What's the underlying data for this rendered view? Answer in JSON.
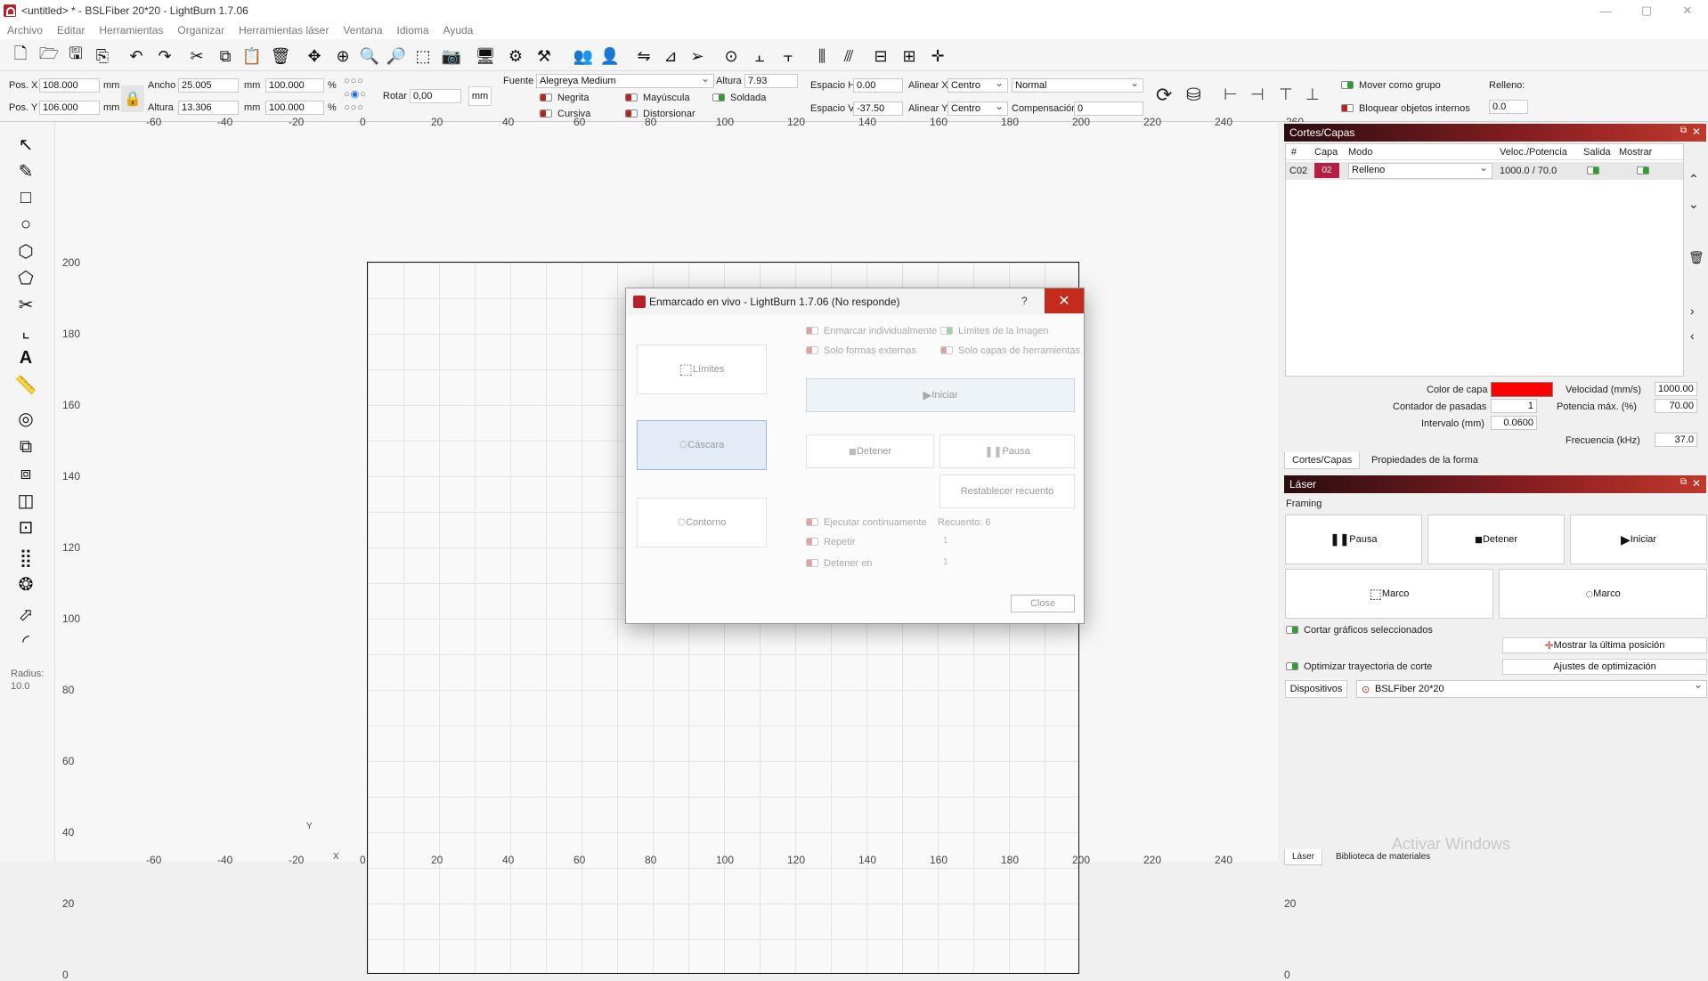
{
  "window": {
    "title": "<untitled> * - BSLFiber 20*20 - LightBurn 1.7.06",
    "minimize": "—",
    "maximize": "▢",
    "close": "✕"
  },
  "menu": [
    "Archivo",
    "Editar",
    "Herramientas",
    "Organizar",
    "Herramientas láser",
    "Ventana",
    "Idioma",
    "Ayuda"
  ],
  "shape_props": {
    "posx_label": "Pos. X",
    "posx_value": "108.000",
    "posy_label": "Pos. Y",
    "posy_value": "106.000",
    "unit": "mm",
    "width_label": "Ancho",
    "width_value": "25.005",
    "height_label": "Altura",
    "height_value": "13.306",
    "width_pct": "100.000",
    "height_pct": "100.000",
    "pct": "%",
    "rotate_label": "Rotar",
    "rotate_value": "0,00",
    "mm_button": "mm"
  },
  "text_props": {
    "font_label": "Fuente",
    "font_value": "Alegreya Medium",
    "height_label": "Altura",
    "height_value": "7.93",
    "bold": "Negrita",
    "italic": "Cursiva",
    "upper": "Mayúscula",
    "distort": "Distorsionar",
    "weld": "Soldada",
    "hspace_label": "Espacio H",
    "hspace_value": "0.00",
    "vspace_label": "Espacio V",
    "vspace_value": "-37.50",
    "alignx_label": "Alinear X",
    "alignx_value": "Centro",
    "aligny_label": "Alinear Y",
    "aligny_value": "Centro",
    "mode_value": "Normal",
    "comp_label": "Compensación",
    "comp_value": "0",
    "move_group": "Mover como grupo",
    "lock_inner": "Bloquear objetos internos",
    "fill_label": "Relleno:",
    "fill_value": "0.0"
  },
  "left_radius": {
    "label": "Radius:",
    "value": "10.0"
  },
  "ruler": {
    "x": [
      "-60",
      "-40",
      "-20",
      "0",
      "20",
      "40",
      "60",
      "80",
      "100",
      "120",
      "140",
      "160",
      "180",
      "200",
      "220",
      "240",
      "260"
    ],
    "y": [
      "200",
      "180",
      "160",
      "140",
      "120",
      "100",
      "80",
      "60",
      "40",
      "20",
      "0"
    ],
    "x_axis": "X",
    "y_axis": "Y"
  },
  "cuts_panel": {
    "title": "Cortes/Capas",
    "headers": [
      "#",
      "Capa",
      "Modo",
      "Veloc./Potencia",
      "Salida",
      "Mostrar"
    ],
    "row": {
      "id": "C02",
      "layer": "02",
      "mode": "Relleno",
      "speed_power": "1000.0 / 70.0"
    },
    "layer_color_label": "Color de capa",
    "layer_color": "#ff0000",
    "speed_label": "Velocidad (mm/s)",
    "speed_value": "1000.00",
    "passes_label": "Contador de pasadas",
    "passes_value": "1",
    "maxpower_label": "Potencia máx. (%)",
    "maxpower_value": "70.00",
    "interval_label": "Intervalo (mm)",
    "interval_value": "0.0600",
    "freq_label": "Frecuencia (kHz)",
    "freq_value": "37.0",
    "tab1": "Cortes/Capas",
    "tab2": "Propiedades de la forma"
  },
  "laser_panel": {
    "title": "Láser",
    "framing": "Framing",
    "pause": "Pausa",
    "stop": "Detener",
    "start": "Iniciar",
    "frame1": "Marco",
    "frame2": "Marco",
    "cut_selected": "Cortar gráficos seleccionados",
    "show_last": "Mostrar la última posición",
    "optimize": "Optimizar trayectoria de corte",
    "opt_settings": "Ajustes de optimización",
    "devices": "Dispositivos",
    "device_value": "BSLFiber 20*20",
    "tab1": "Láser",
    "tab2": "Biblioteca de materiales"
  },
  "dialog": {
    "title": "Enmarcado en vivo - LightBurn 1.7.06 (No responde)",
    "help": "?",
    "close": "✕",
    "limits": "Límites",
    "shell": "Cáscara",
    "contour": "Contorno",
    "frame_individually": "Enmarcar individualmente",
    "image_limits": "Límites de la imagen",
    "only_outer": "Solo formas externas",
    "only_tool_layers": "Solo capas de herramientas",
    "start": "Iniciar",
    "stop": "Detener",
    "pause": "Pausa",
    "reset_count": "Restablecer recuento",
    "run_continuously": "Ejecutar continuamente",
    "count": "Recuento: 6",
    "repeat": "Repetir",
    "repeat_value": "1",
    "stop_at": "Detener en",
    "stop_at_value": "1",
    "close_button": "Close"
  },
  "watermark": "Activar Windows"
}
